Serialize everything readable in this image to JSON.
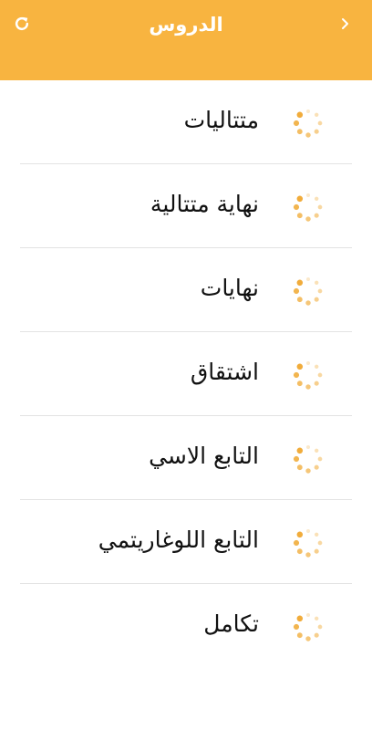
{
  "header": {
    "title": "الدروس",
    "back_icon": "chevron-right-icon",
    "refresh_icon": "refresh-icon"
  },
  "colors": {
    "accent": "#f8b440",
    "spinner": "#f0a830",
    "divider": "#e3e3e3"
  },
  "lessons": [
    {
      "label": "متتاليات",
      "icon": "loading-spinner-icon"
    },
    {
      "label": "نهاية متتالية",
      "icon": "loading-spinner-icon"
    },
    {
      "label": "نهايات",
      "icon": "loading-spinner-icon"
    },
    {
      "label": "اشتقاق",
      "icon": "loading-spinner-icon"
    },
    {
      "label": "التابع الاسي",
      "icon": "loading-spinner-icon"
    },
    {
      "label": "التابع اللوغاريتمي",
      "icon": "loading-spinner-icon"
    },
    {
      "label": "تكامل",
      "icon": "loading-spinner-icon"
    }
  ]
}
